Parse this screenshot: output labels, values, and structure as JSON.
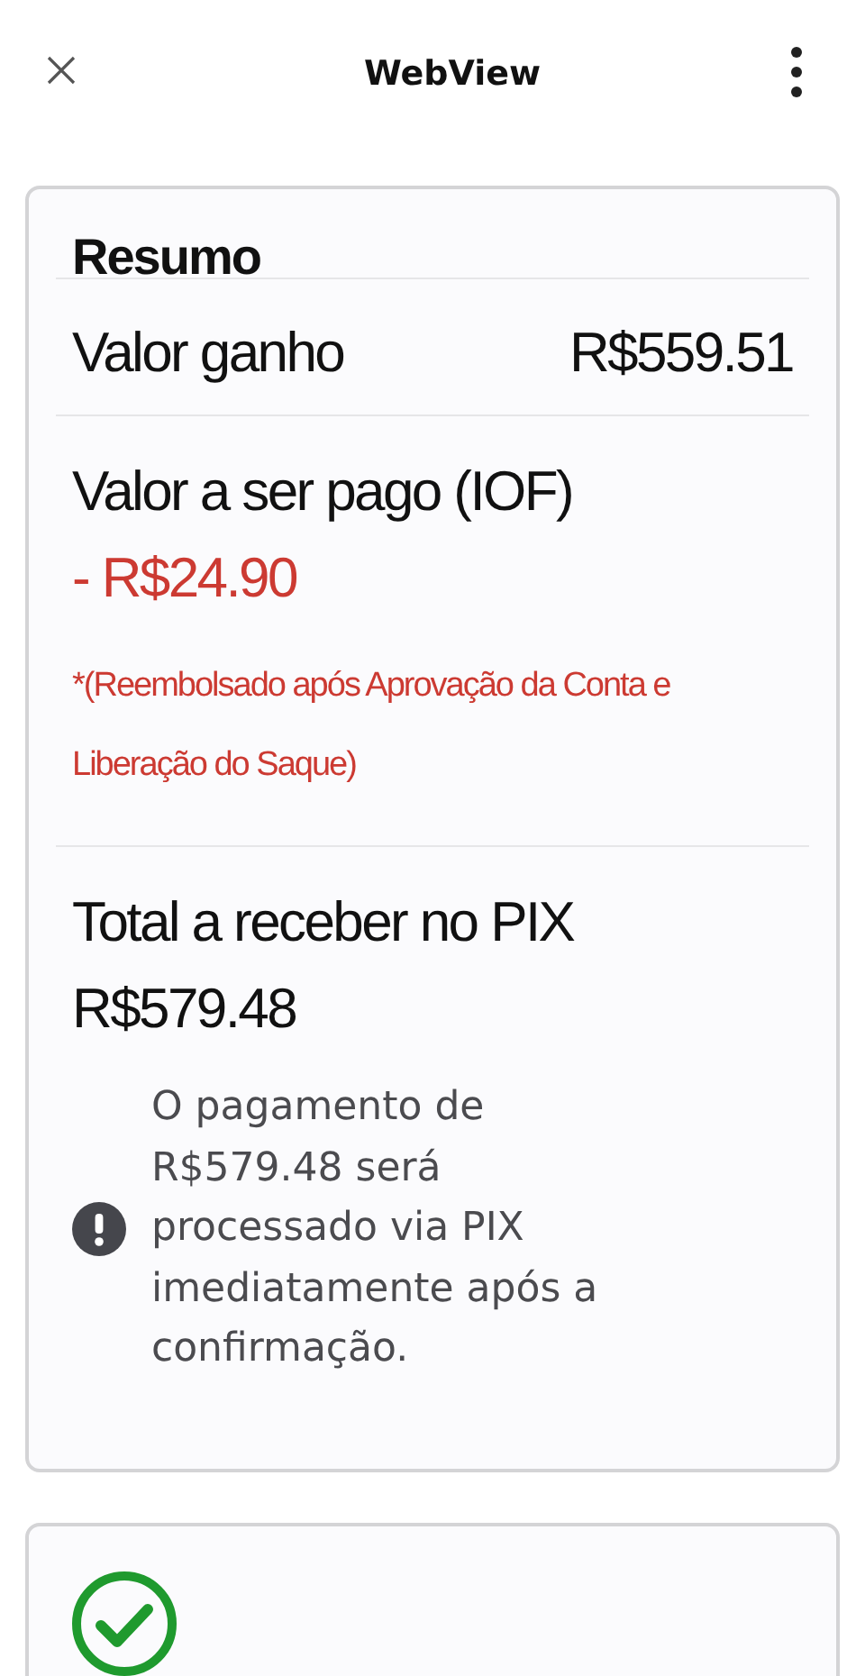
{
  "header": {
    "title": "WebView"
  },
  "summary": {
    "title": "Resumo",
    "earned": {
      "label": "Valor ganho",
      "value": "R$559.51"
    },
    "fee": {
      "label": "Valor a ser pago (IOF)",
      "value": "- R$24.90",
      "note": "*(Reembolsado após Aprovação da Conta e Liberação do Saque)"
    },
    "total": {
      "label": "Total a receber no PIX",
      "value": "R$579.48"
    },
    "info": "O pagamento de R$579.48 será processado via PIX imediatamente após a confirmação."
  }
}
